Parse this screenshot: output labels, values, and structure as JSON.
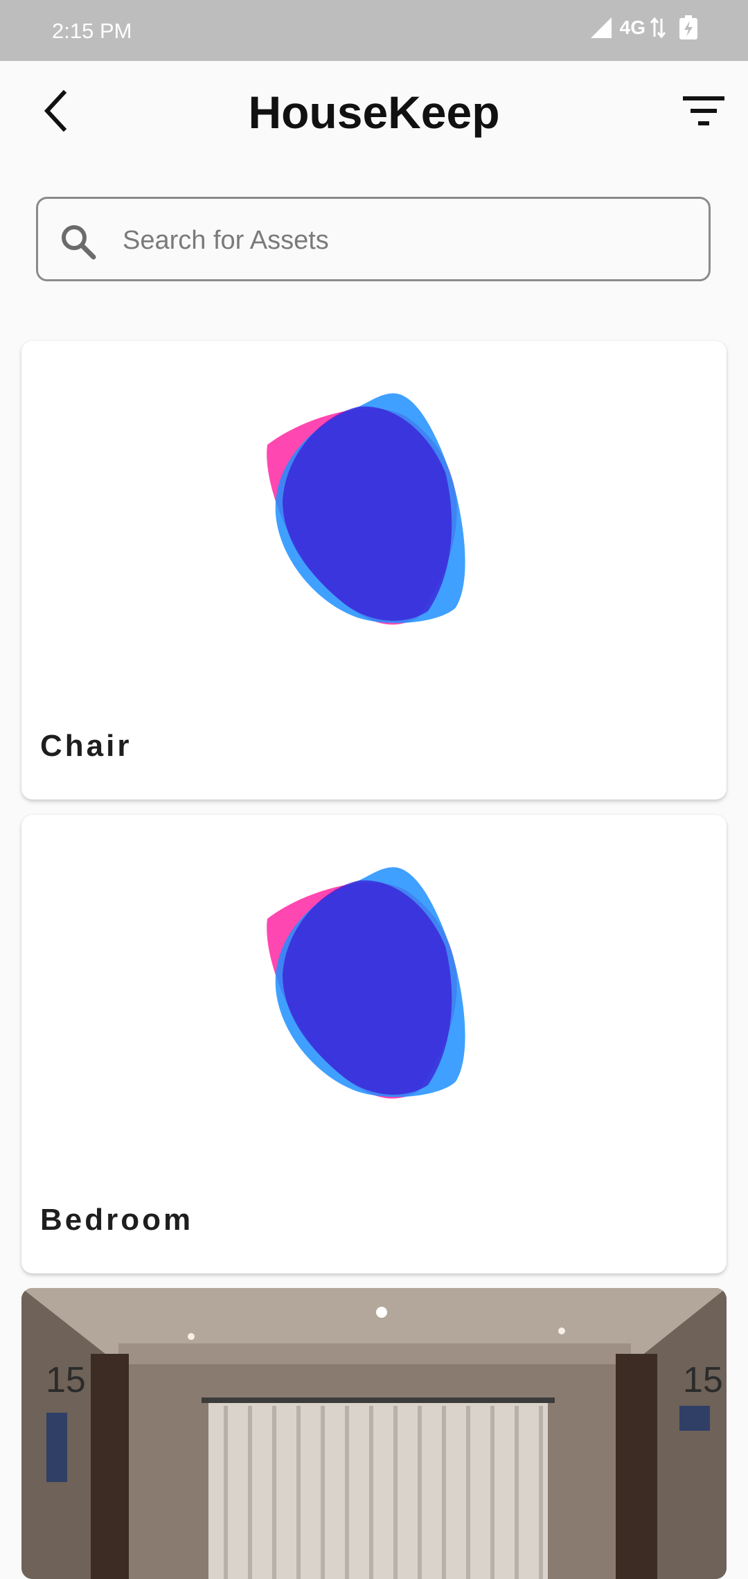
{
  "status_bar": {
    "time": "2:15 PM",
    "network": "4G"
  },
  "header": {
    "title": "HouseKeep",
    "back_icon": "chevron-left-icon",
    "filter_icon": "filter-icon"
  },
  "search": {
    "placeholder": "Search for Assets",
    "value": ""
  },
  "assets": [
    {
      "label": "Chair",
      "image": "blob-logo"
    },
    {
      "label": "Bedroom",
      "image": "blob-logo"
    },
    {
      "label": "",
      "image": "hotel-hallway-photo"
    }
  ],
  "colors": {
    "status_bar": "#bdbdbd",
    "background": "#fafafa",
    "card": "#ffffff",
    "blob_pink": "#ff1fa0",
    "blob_blue": "#1f8fff",
    "blob_overlap": "#3a1bd6"
  }
}
